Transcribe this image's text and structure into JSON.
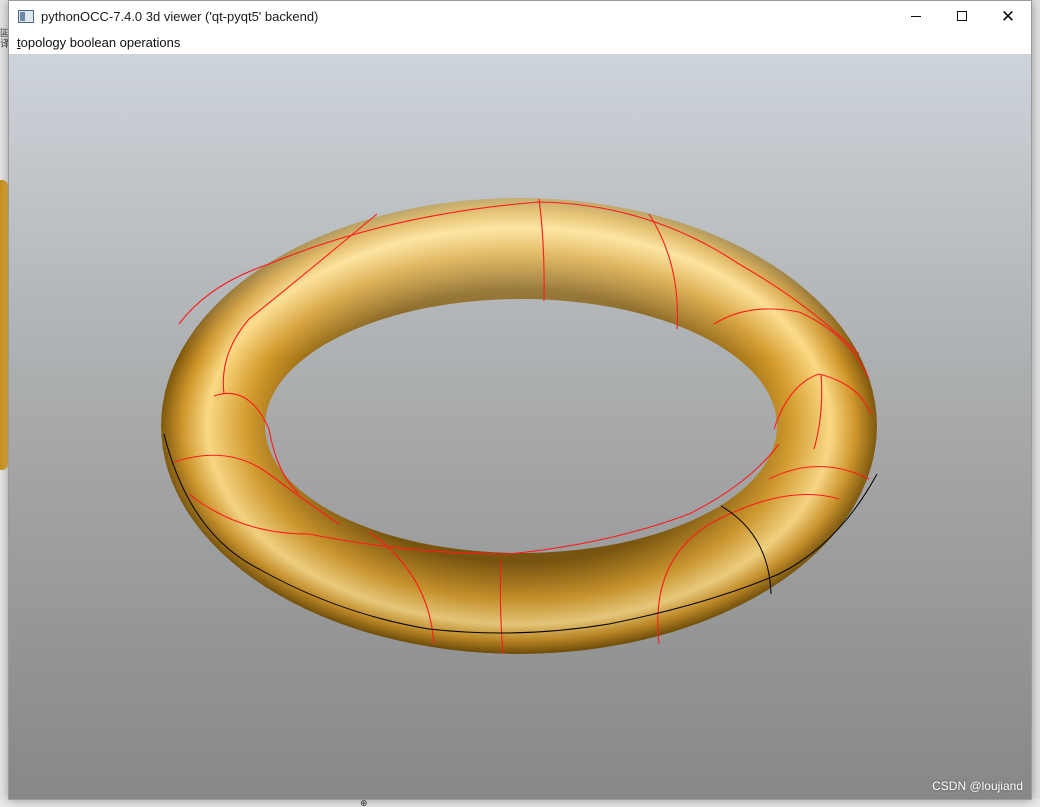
{
  "window": {
    "title": "pythonOCC-7.4.0 3d viewer ('qt-pyqt5' backend)",
    "minimize_label": "—",
    "maximize_label": "☐",
    "close_label": "✕"
  },
  "menu": {
    "items": [
      {
        "accelerator": "t",
        "rest": "opology boolean operations"
      }
    ]
  },
  "viewport": {
    "shape": "torus",
    "shape_color": "#d9a135",
    "edge_colors": {
      "section_edges": "#ff1a1a",
      "seam_edges": "#000000"
    },
    "background_top": "#cdd4da",
    "background_bottom": "#878787"
  },
  "watermark": "CSDN @loujiand",
  "background": {
    "left_glyph": "囸\n译",
    "bottom_glyph": "⊕"
  }
}
